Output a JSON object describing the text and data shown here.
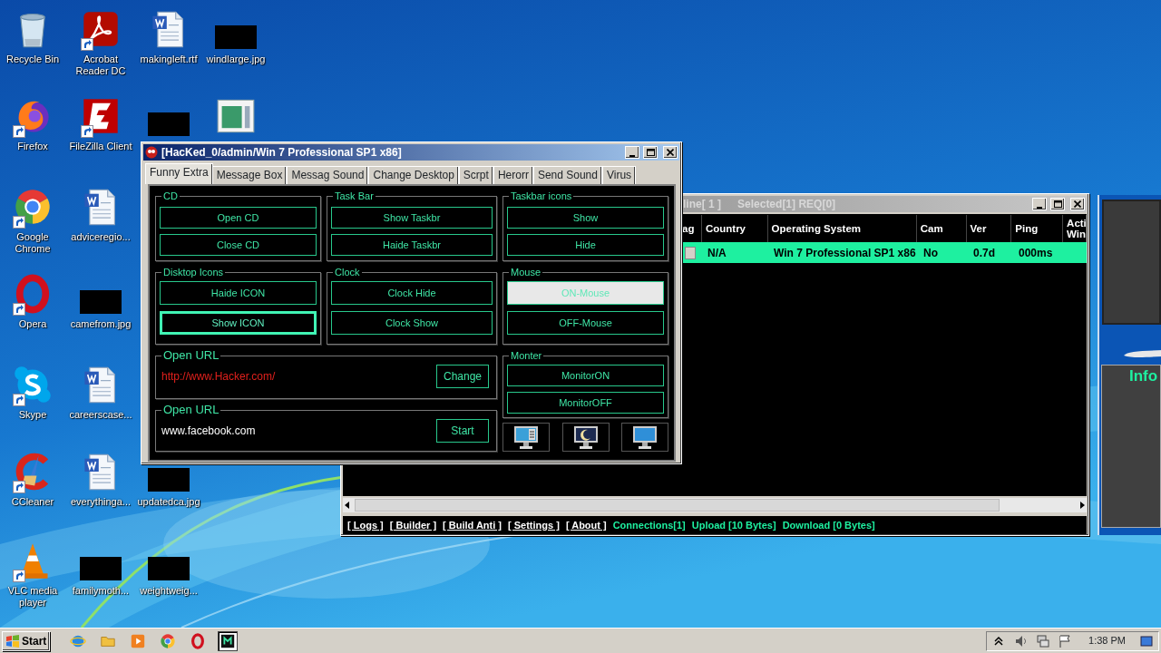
{
  "desktop_columns": [
    [
      {
        "label": "Recycle Bin",
        "kind": "recycle",
        "shortcut": false
      },
      {
        "label": "Firefox",
        "kind": "firefox",
        "shortcut": true
      },
      {
        "label": "Google Chrome",
        "kind": "chrome",
        "shortcut": true
      },
      {
        "label": "Opera",
        "kind": "opera",
        "shortcut": true
      },
      {
        "label": "Skype",
        "kind": "skype",
        "shortcut": true
      },
      {
        "label": "CCleaner",
        "kind": "ccleaner",
        "shortcut": true
      },
      {
        "label": "VLC media player",
        "kind": "vlc",
        "shortcut": true
      }
    ],
    [
      {
        "label": "Acrobat Reader DC",
        "kind": "acrobat",
        "shortcut": true
      },
      {
        "label": "FileZilla Client",
        "kind": "filezilla",
        "shortcut": true
      },
      {
        "label": "adviceregio...",
        "kind": "word",
        "shortcut": false
      },
      {
        "label": "camefrom.jpg",
        "kind": "redacted",
        "shortcut": false
      },
      {
        "label": "careerscase...",
        "kind": "word",
        "shortcut": false
      },
      {
        "label": "everythinga...",
        "kind": "word",
        "shortcut": false
      },
      {
        "label": "familymoth...",
        "kind": "redacted",
        "shortcut": false
      }
    ],
    [
      {
        "label": "makingleft.rtf",
        "kind": "word",
        "shortcut": false
      },
      {
        "kind": "redacted",
        "shortcut": false
      },
      {
        "label": "updatedca.jpg",
        "kind": "redacted",
        "shortcut": false
      },
      {
        "label": "weightweig...",
        "kind": "redacted",
        "shortcut": false
      }
    ],
    [
      {
        "label": "windlarge.jpg",
        "kind": "redacted",
        "shortcut": false
      },
      {
        "kind": "window",
        "shortcut": false
      }
    ]
  ],
  "client_window": {
    "title": "line[ 1 ]",
    "title_info": "Selected[1] REQ[0]",
    "columns": [
      "ag",
      "Country",
      "Operating System",
      "Cam",
      "Ver",
      "Ping",
      "Acti Win"
    ],
    "rows": [
      {
        "selected": true,
        "checked": false,
        "cells": [
          "",
          "N/A",
          "Win 7 Professional SP1 x86",
          "No",
          "0.7d",
          "000ms"
        ]
      }
    ],
    "links": [
      "[ Logs ]",
      "[ Builder ]",
      "[ Build Anti ]",
      "[ Settings ]",
      "[ About ]"
    ],
    "status": [
      "Connections[1]",
      "Upload [10 Bytes]",
      "Download [0 Bytes]"
    ]
  },
  "side_panel": {
    "label": "Info"
  },
  "main_window": {
    "title": "[HacKed_0/admin/Win 7 Professional SP1 x86]",
    "tabs": [
      {
        "label": "Funny Extra",
        "selected": true
      },
      {
        "label": "Message Box",
        "selected": false
      },
      {
        "label": "Messag Sound",
        "selected": false
      },
      {
        "label": "Change Desktop",
        "selected": false
      },
      {
        "label": "Scrpt",
        "selected": false
      },
      {
        "label": "Herorr",
        "selected": false
      },
      {
        "label": "Send Sound",
        "selected": false
      },
      {
        "label": "Virus",
        "selected": false
      }
    ],
    "groups": [
      {
        "title": "CD",
        "buttons": [
          {
            "label": "Open CD",
            "pressed": false,
            "focused": false
          },
          {
            "label": "Close CD",
            "pressed": false,
            "focused": false
          }
        ]
      },
      {
        "title": "Task Bar",
        "buttons": [
          {
            "label": "Show Taskbr",
            "pressed": false,
            "focused": false
          },
          {
            "label": "Haide Taskbr",
            "pressed": false,
            "focused": false
          }
        ]
      },
      {
        "title": "Taskbar icons",
        "buttons": [
          {
            "label": "Show",
            "pressed": false,
            "focused": false
          },
          {
            "label": "Hide",
            "pressed": false,
            "focused": false
          }
        ]
      },
      {
        "title": "Disktop  Icons",
        "buttons": [
          {
            "label": "Haide ICON",
            "pressed": false,
            "focused": false
          },
          {
            "label": "Show ICON",
            "pressed": false,
            "focused": true
          }
        ]
      },
      {
        "title": "Clock",
        "buttons": [
          {
            "label": "Clock Hide",
            "pressed": false,
            "focused": false
          },
          {
            "label": "Clock Show",
            "pressed": false,
            "focused": false
          }
        ]
      },
      {
        "title": "Mouse",
        "buttons": [
          {
            "label": "ON-Mouse",
            "pressed": true,
            "focused": false
          },
          {
            "label": "OFF-Mouse",
            "pressed": false,
            "focused": false
          }
        ]
      }
    ],
    "url_groups": [
      {
        "title": "Open URL",
        "value": "http://www.Hacker.com/",
        "color": "#e0201c",
        "button": "Change"
      },
      {
        "title": "Open URL",
        "value": "www.facebook.com",
        "color": "#ffffff",
        "button": "Start"
      }
    ],
    "monitor_group": {
      "title": "Monter",
      "buttons": [
        {
          "label": "MonitorON",
          "pressed": false,
          "focused": false
        },
        {
          "label": "MonitorOFF",
          "pressed": false,
          "focused": false
        }
      ]
    },
    "icon_buttons": [
      {
        "kind": "panel"
      },
      {
        "kind": "moon"
      },
      {
        "kind": "blank"
      }
    ]
  },
  "taskbar": {
    "start": "Start",
    "quick_launch": [
      {
        "kind": "ie",
        "active": false
      },
      {
        "kind": "folder",
        "active": false
      },
      {
        "kind": "media",
        "active": false
      },
      {
        "kind": "chrome",
        "active": false
      },
      {
        "kind": "opera",
        "active": false
      },
      {
        "kind": "app",
        "active": true
      }
    ],
    "tray": [
      {
        "kind": "chevron"
      },
      {
        "kind": "speaker"
      },
      {
        "kind": "network"
      },
      {
        "kind": "flag"
      }
    ],
    "time": "1:38 PM"
  }
}
